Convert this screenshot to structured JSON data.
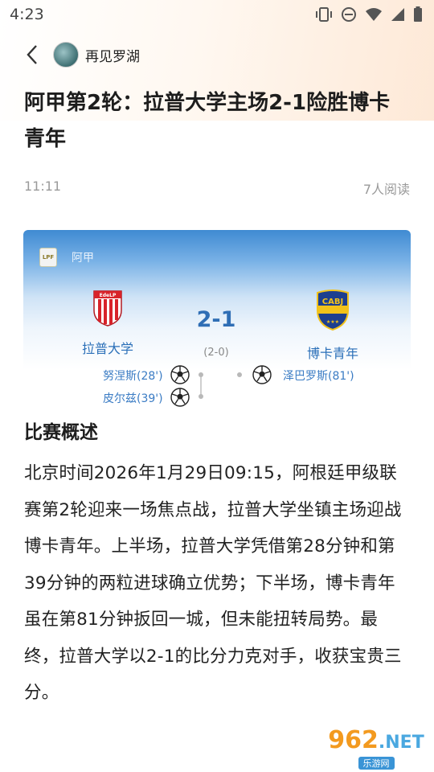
{
  "status_bar": {
    "time": "4:23"
  },
  "nav": {
    "author": "再见罗湖"
  },
  "article": {
    "title": "阿甲第2轮：拉普大学主场2-1险胜博卡青年",
    "time": "11:11",
    "reads": "7人阅读",
    "section_title": "比赛概述",
    "body": "北京时间2026年1月29日09:15，阿根廷甲级联赛第2轮迎来一场焦点战，拉普大学坐镇主场迎战博卡青年。上半场，拉普大学凭借第28分钟和第39分钟的两粒进球确立优势；下半场，博卡青年虽在第81分钟扳回一城，但未能扭转局势。最终，拉普大学以2-1的比分力克对手，收获宝贵三分。"
  },
  "match_card": {
    "league_logo": "LPF",
    "league": "阿甲",
    "home_team": "拉普大学",
    "home_badge": "EdeLP",
    "away_team": "博卡青年",
    "away_badge": "CABJ",
    "score": "2-1",
    "half_time": "(2-0)",
    "home_scorers": [
      "努涅斯(28')",
      "皮尔兹(39')"
    ],
    "away_scorers": [
      "泽巴罗斯(81')"
    ]
  },
  "watermark": {
    "main": "962",
    "suffix": ".NET",
    "sub": "乐游网"
  },
  "colors": {
    "accent_blue": "#2f6eb5",
    "card_top": "#3f8ad2",
    "boca_blue": "#1d3f8f",
    "boca_gold": "#f2c21a",
    "estudiantes_red": "#d8232a"
  }
}
